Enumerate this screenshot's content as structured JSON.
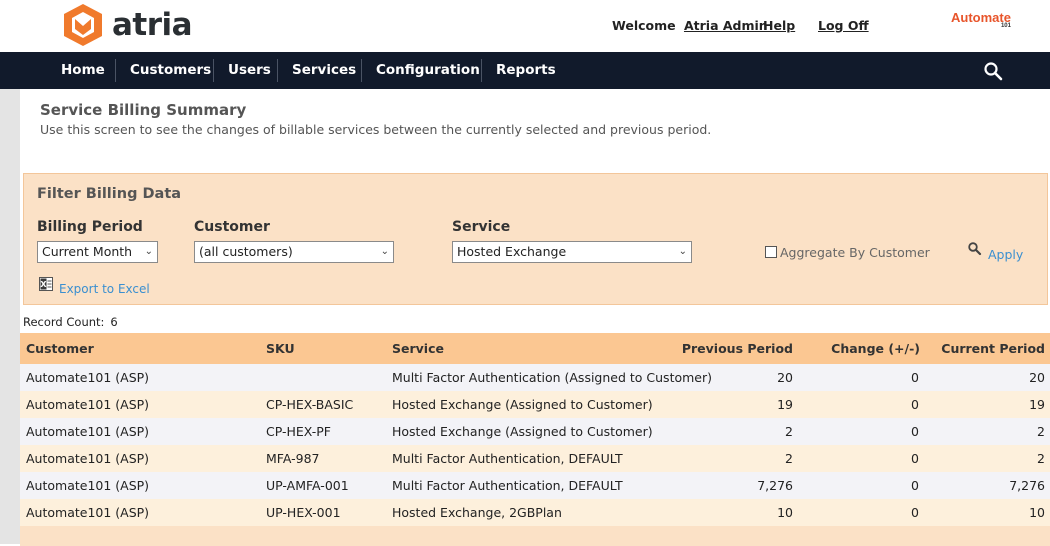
{
  "header": {
    "app_name": "atria",
    "welcome_prefix": "Welcome",
    "user_name": "Atria Admin",
    "help_label": "Help",
    "logoff_label": "Log Off",
    "brand": "Automate",
    "brand_sub": "101"
  },
  "nav": {
    "items": [
      "Home",
      "Customers",
      "Users",
      "Services",
      "Configuration",
      "Reports"
    ]
  },
  "page": {
    "title": "Service Billing Summary",
    "description": "Use this screen to see the changes of billable services between the currently selected and previous period."
  },
  "filter": {
    "title": "Filter Billing Data",
    "billing_period_label": "Billing Period",
    "billing_period_value": "Current Month",
    "customer_label": "Customer",
    "customer_value": "(all customers)",
    "service_label": "Service",
    "service_value": "Hosted Exchange",
    "aggregate_label": "Aggregate By Customer",
    "apply_label": "Apply",
    "export_label": "Export to Excel"
  },
  "record_count": {
    "label": "Record Count:",
    "value": "6"
  },
  "table": {
    "columns": [
      "Customer",
      "SKU",
      "Service",
      "Previous Period",
      "Change (+/-)",
      "Current Period"
    ],
    "rows": [
      [
        "Automate101 (ASP)",
        "",
        "Multi Factor Authentication (Assigned to Customer)",
        "20",
        "0",
        "20"
      ],
      [
        "Automate101 (ASP)",
        "CP-HEX-BASIC",
        "Hosted Exchange (Assigned to Customer)",
        "19",
        "0",
        "19"
      ],
      [
        "Automate101 (ASP)",
        "CP-HEX-PF",
        "Hosted Exchange (Assigned to Customer)",
        "2",
        "0",
        "2"
      ],
      [
        "Automate101 (ASP)",
        "MFA-987",
        "Multi Factor Authentication, DEFAULT",
        "2",
        "0",
        "2"
      ],
      [
        "Automate101 (ASP)",
        "UP-AMFA-001",
        "Multi Factor Authentication, DEFAULT",
        "7,276",
        "0",
        "7,276"
      ],
      [
        "Automate101 (ASP)",
        "UP-HEX-001",
        "Hosted Exchange, 2GBPlan",
        "10",
        "0",
        "10"
      ]
    ]
  },
  "colors": {
    "nav_bg": "#111a2b",
    "accent_orange": "#e8552b",
    "filter_bg": "#fbe1c6",
    "table_header_bg": "#fbc792",
    "link_blue": "#3a8fd0"
  }
}
